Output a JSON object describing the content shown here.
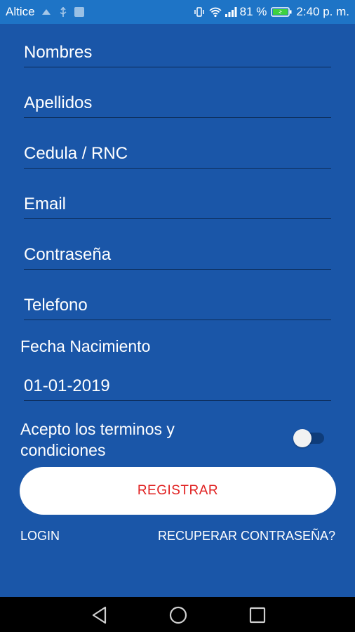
{
  "status_bar": {
    "carrier": "Altice",
    "battery_percent": "81 %",
    "time": "2:40 p. m."
  },
  "form": {
    "nombres_placeholder": "Nombres",
    "apellidos_placeholder": "Apellidos",
    "cedula_placeholder": "Cedula / RNC",
    "email_placeholder": "Email",
    "password_placeholder": "Contraseña",
    "telefono_placeholder": "Telefono",
    "birthdate_label": "Fecha Nacimiento",
    "birthdate_value": "01-01-2019",
    "terms_line1": "Acepto los terminos y",
    "terms_line2": "condiciones",
    "terms_accepted": false
  },
  "actions": {
    "register_label": "REGISTRAR",
    "login_label": "LOGIN",
    "recover_label": "RECUPERAR CONTRASEÑA?"
  },
  "colors": {
    "background": "#1a56a8",
    "status_bar": "#1e74c6",
    "button_text": "#e02020"
  },
  "icons": {
    "status": [
      "notification-icon",
      "usb-icon",
      "image-icon",
      "vibrate-icon",
      "wifi-icon",
      "signal-icon",
      "battery-icon"
    ],
    "nav": [
      "back-icon",
      "home-icon",
      "recents-icon"
    ]
  }
}
